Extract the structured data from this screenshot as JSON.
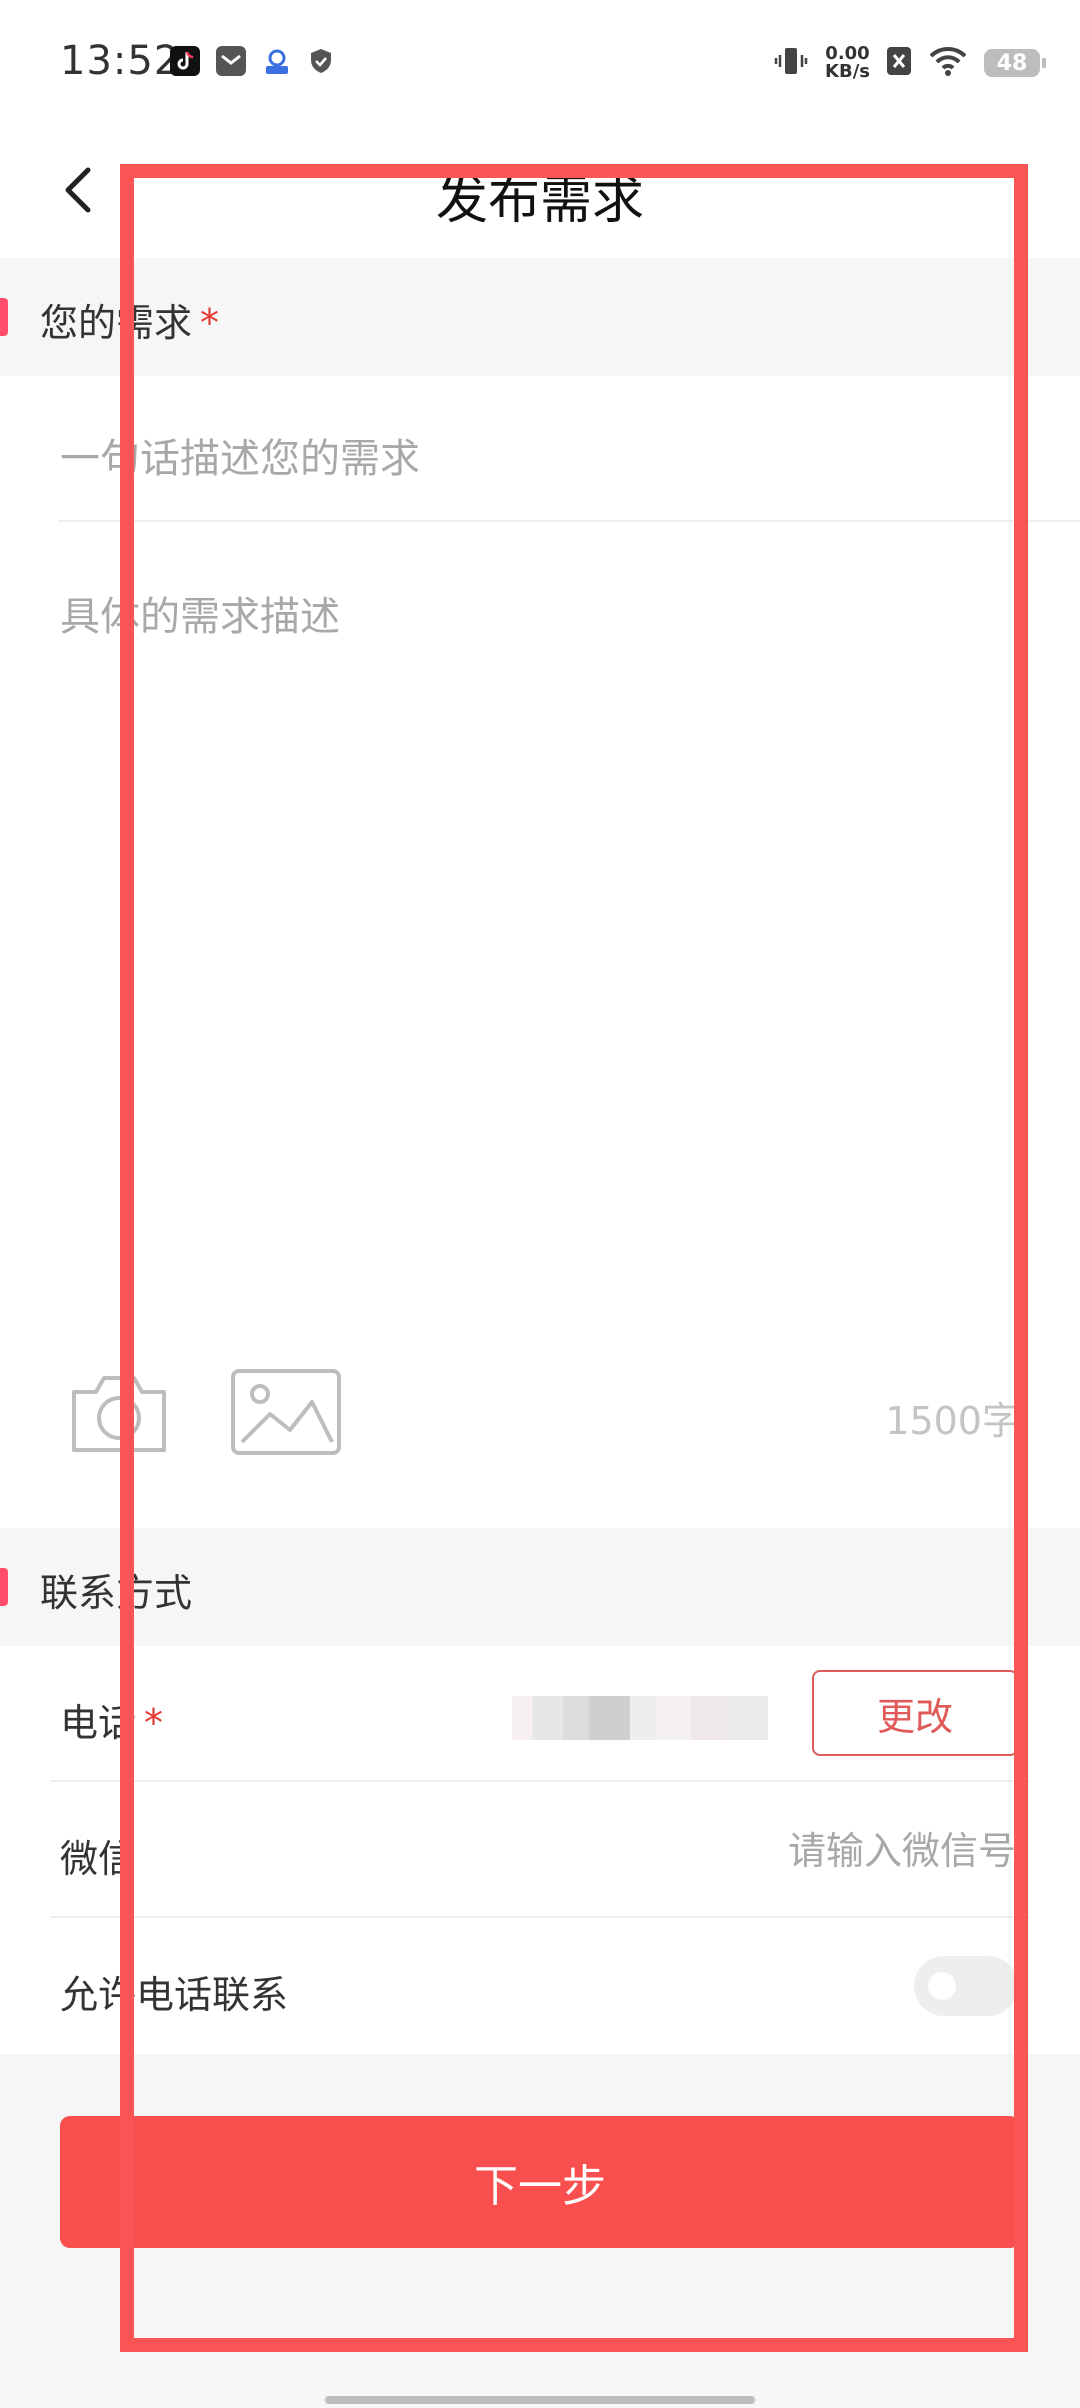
{
  "status_bar": {
    "time": "13:52",
    "net_speed_value": "0.00",
    "net_speed_unit": "KB/s",
    "battery": "48",
    "icons": [
      "tiktok-icon",
      "mail-icon",
      "vpn-icon",
      "shield-icon",
      "vibrate-icon",
      "sim-off-icon",
      "wifi-icon",
      "battery-icon"
    ]
  },
  "nav": {
    "title": "发布需求"
  },
  "demand_section": {
    "title": "您的需求",
    "required_mark": "*",
    "title_placeholder": "一句话描述您的需求",
    "desc_placeholder": "具体的需求描述",
    "char_count": "1500字"
  },
  "contact_section": {
    "title": "联系方式",
    "phone_label": "电话",
    "phone_required_mark": "*",
    "change_label": "更改",
    "wechat_label": "微信",
    "wechat_placeholder": "请输入微信号",
    "allow_call_label": "允许电话联系",
    "allow_call_enabled": false
  },
  "next_label": "下一步",
  "colors": {
    "accent": "#f94f4f",
    "required": "#e53935",
    "section_bar": "#ff4d6a",
    "highlight_box": "#f95555"
  }
}
